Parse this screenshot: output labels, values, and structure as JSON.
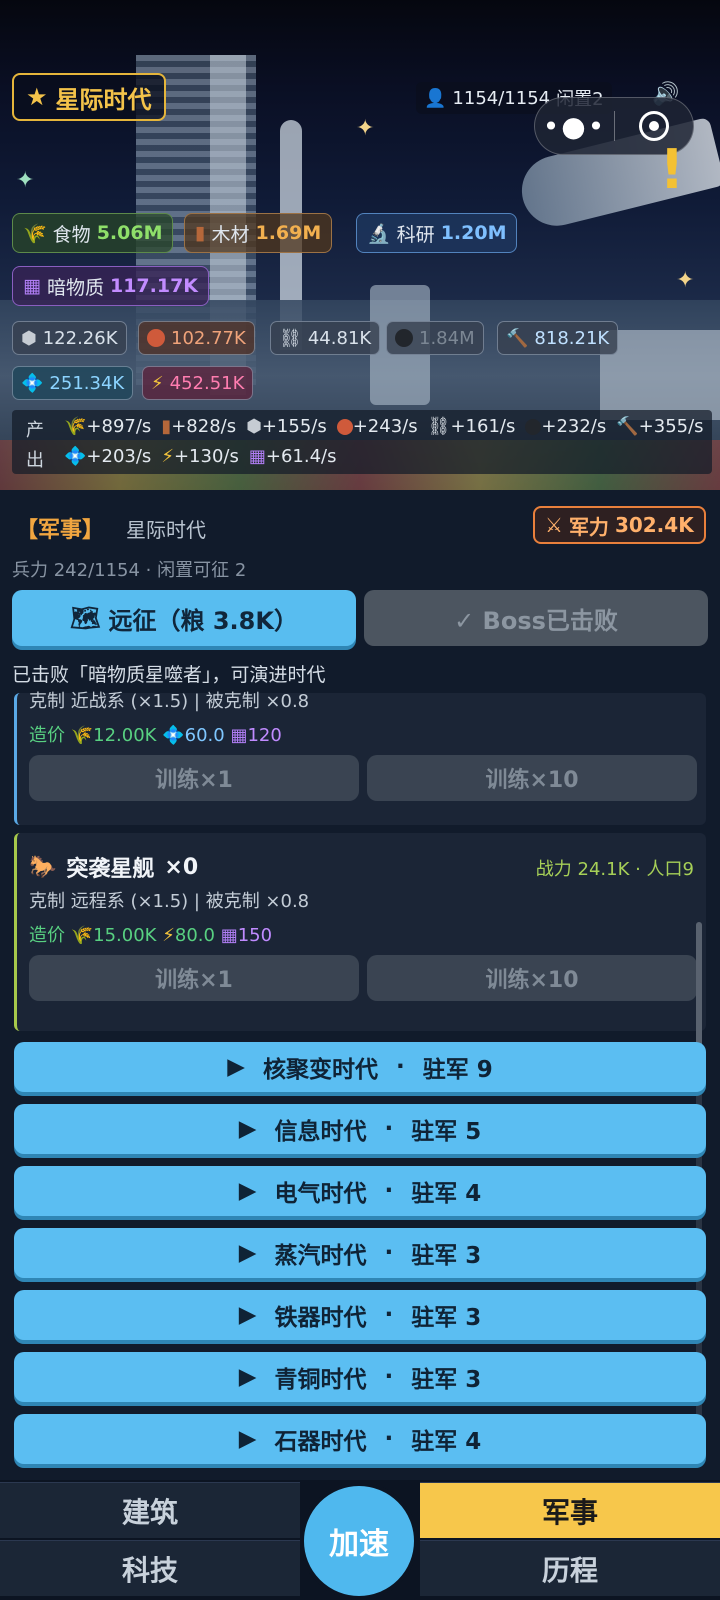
{
  "header": {
    "era_title": "星际时代",
    "population": "1154/1154",
    "idle": "闲置2",
    "resources": {
      "food": {
        "label": "食物",
        "value": "5.06M"
      },
      "wood": {
        "label": "木材",
        "value": "1.69M"
      },
      "research": {
        "label": "科研",
        "value": "1.20M"
      },
      "dark_matter": {
        "label": "暗物质",
        "value": "117.17K"
      }
    },
    "materials": [
      "122.26K",
      "102.77K",
      "44.81K",
      "1.84M",
      "818.21K",
      "251.34K",
      "452.51K"
    ],
    "production": {
      "label_top": "产",
      "label_bottom": "出",
      "row1": [
        "+897/s",
        "+828/s",
        "+155/s",
        "+243/s",
        "+161/s",
        "+232/s",
        "+355/s"
      ],
      "row2": [
        "+203/s",
        "+130/s",
        "+61.4/s"
      ]
    }
  },
  "military": {
    "title": "【军事】",
    "era": "星际时代",
    "power_label": "军力",
    "power_value": "302.4K",
    "troops": "兵力 242/1154 · 闲置可征 2",
    "expedition_label": "远征（粮 3.8K）",
    "boss_label": "✓ Boss已击败",
    "defeated_text": "已击败「暗物质星噬者」，可演进时代",
    "unit1": {
      "counter": "克制 近战系 (×1.5) | 被克制 ×0.8",
      "cost_label": "造价",
      "cost1": "12.00K",
      "cost2": "60.0",
      "cost3": "120",
      "train1": "训练×1",
      "train10": "训练×10"
    },
    "unit2": {
      "name": "突袭星舰",
      "count": "×0",
      "stats": "战力 24.1K · 人口9",
      "counter": "克制 远程系 (×1.5) | 被克制 ×0.8",
      "cost_label": "造价",
      "cost1": "15.00K",
      "cost2": "80.0",
      "cost3": "150",
      "train1": "训练×1",
      "train10": "训练×10"
    },
    "eras": [
      {
        "name": "核聚变时代",
        "garrison": "驻军 9"
      },
      {
        "name": "信息时代",
        "garrison": "驻军 5"
      },
      {
        "name": "电气时代",
        "garrison": "驻军 4"
      },
      {
        "name": "蒸汽时代",
        "garrison": "驻军 3"
      },
      {
        "name": "铁器时代",
        "garrison": "驻军 3"
      },
      {
        "name": "青铜时代",
        "garrison": "驻军 3"
      },
      {
        "name": "石器时代",
        "garrison": "驻军 4"
      }
    ]
  },
  "nav": {
    "buildings": "建筑",
    "tech": "科技",
    "speed": "加速",
    "military": "军事",
    "history": "历程"
  },
  "colors": {
    "accent": "#5bbef2",
    "active_tab": "#f7c74b",
    "power": "#e9803c"
  }
}
